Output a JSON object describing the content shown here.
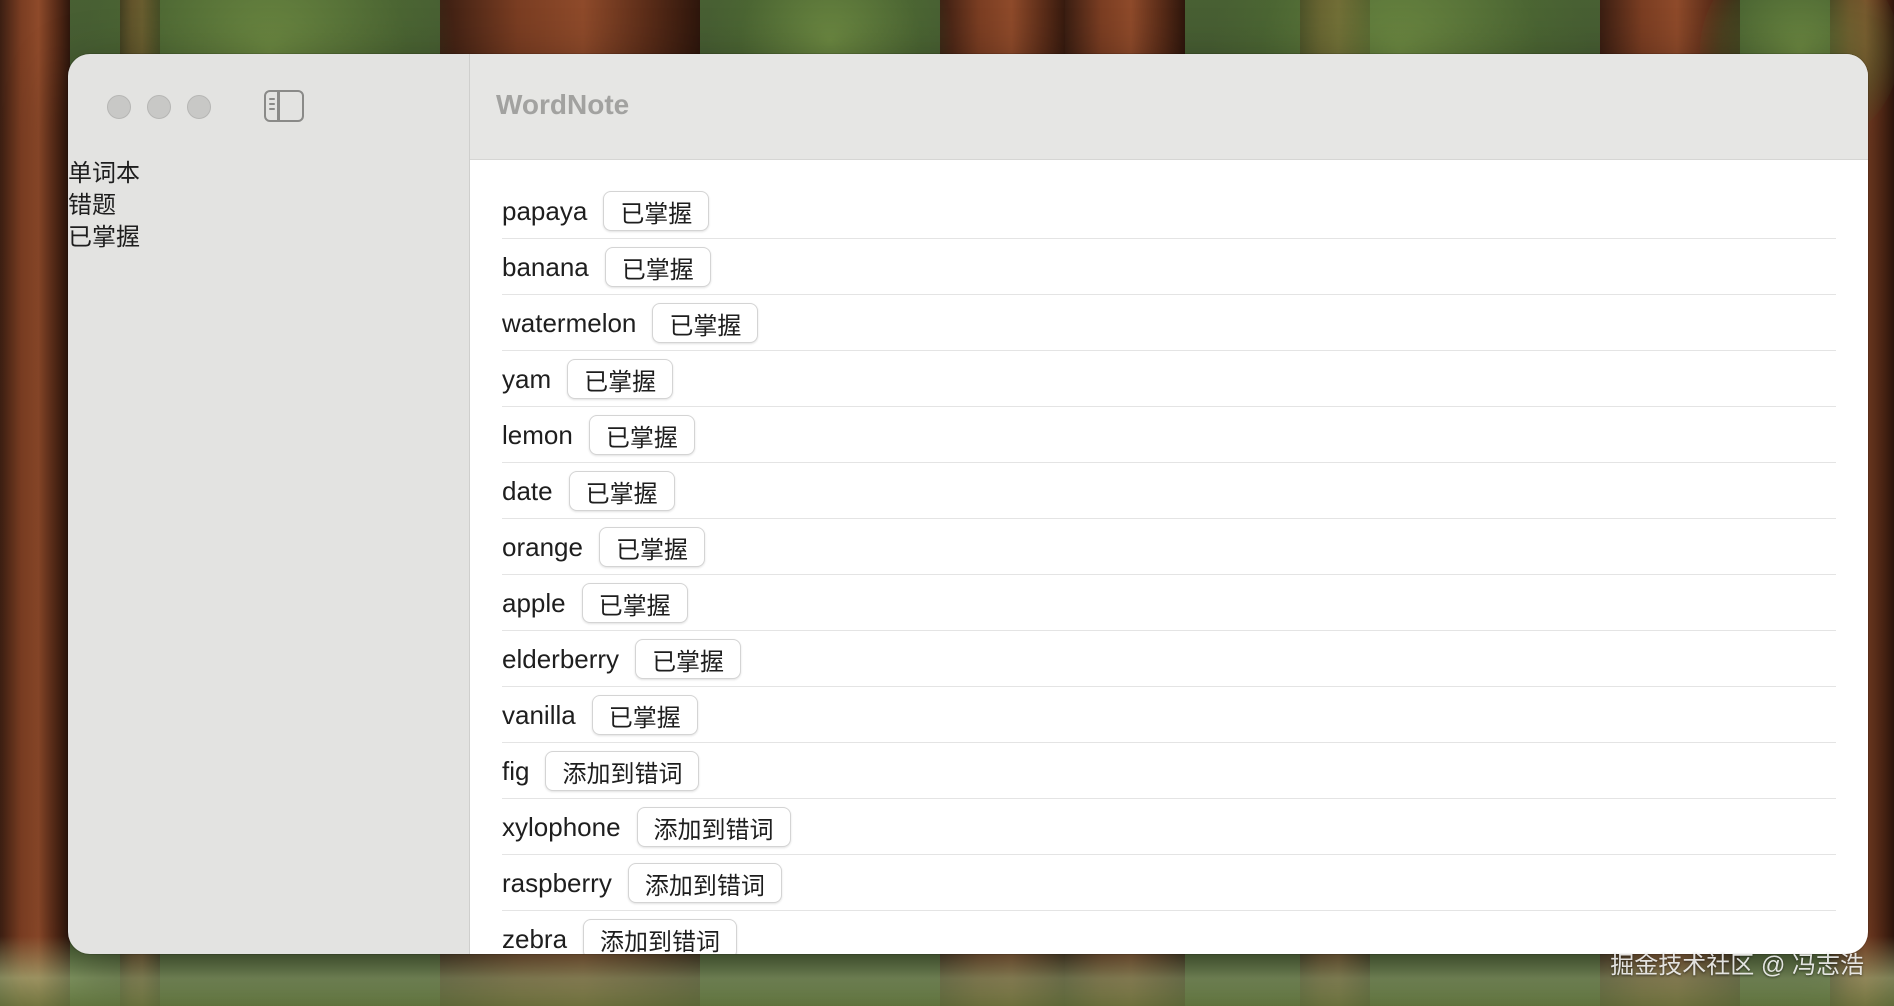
{
  "app": {
    "title": "WordNote"
  },
  "sidebar": {
    "items": [
      {
        "label": "单词本"
      },
      {
        "label": "错题"
      },
      {
        "label": "已掌握"
      }
    ]
  },
  "words": [
    {
      "word": "papaya",
      "action": "已掌握"
    },
    {
      "word": "banana",
      "action": "已掌握"
    },
    {
      "word": "watermelon",
      "action": "已掌握"
    },
    {
      "word": "yam",
      "action": "已掌握"
    },
    {
      "word": "lemon",
      "action": "已掌握"
    },
    {
      "word": "date",
      "action": "已掌握"
    },
    {
      "word": "orange",
      "action": "已掌握"
    },
    {
      "word": "apple",
      "action": "已掌握"
    },
    {
      "word": "elderberry",
      "action": "已掌握"
    },
    {
      "word": "vanilla",
      "action": "已掌握"
    },
    {
      "word": "fig",
      "action": "添加到错词"
    },
    {
      "word": "xylophone",
      "action": "添加到错词"
    },
    {
      "word": "raspberry",
      "action": "添加到错词"
    },
    {
      "word": "zebra",
      "action": "添加到错词"
    }
  ],
  "watermark": "掘金技术社区 @ 冯志浩",
  "icons": {
    "traffic_lights": [
      "close-icon",
      "minimize-icon",
      "zoom-icon"
    ],
    "sidebar_toggle": "sidebar-toggle-icon"
  },
  "colors": {
    "sidebar_bg": "#e3e3e1",
    "toolbar_bg": "#e6e6e4",
    "title_color": "#a2a2a0",
    "content_bg": "#ffffff"
  }
}
